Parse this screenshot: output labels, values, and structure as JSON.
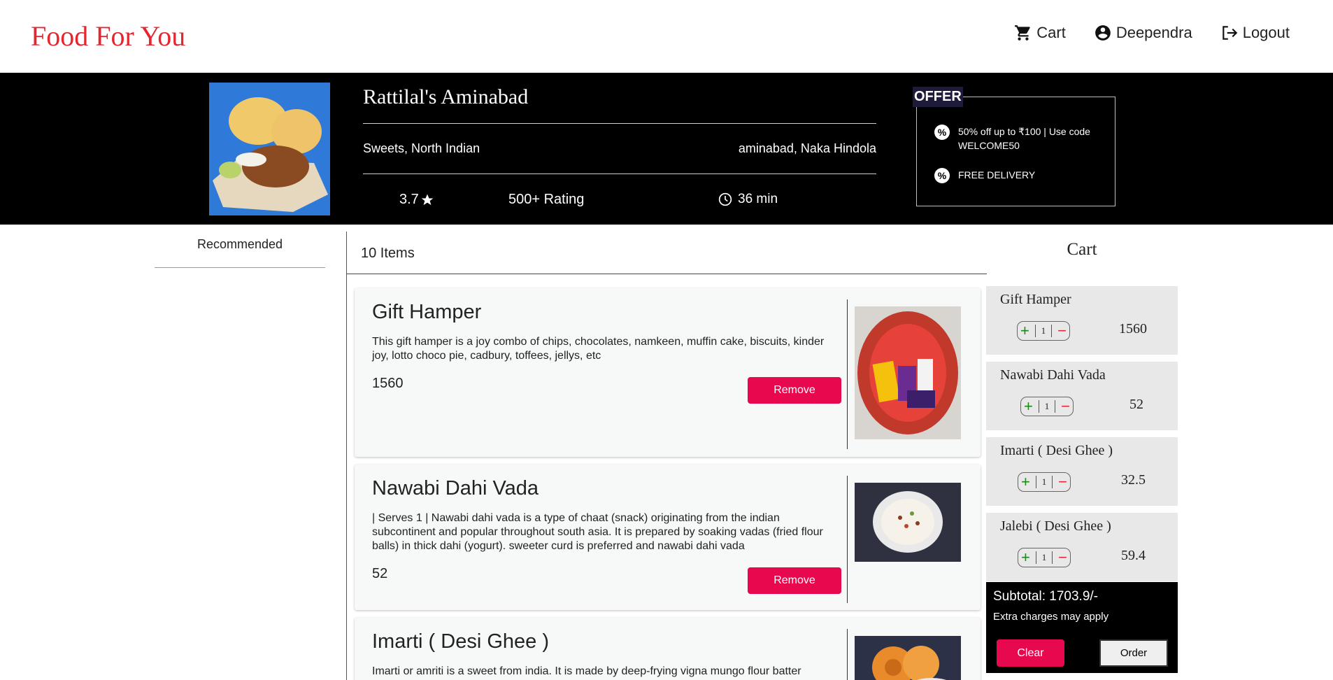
{
  "header": {
    "brand": "Food For You",
    "nav": {
      "cart_label": "Cart",
      "user_label": "Deependra",
      "logout_label": "Logout"
    }
  },
  "restaurant": {
    "name": "Rattilal's Aminabad",
    "cuisines": "Sweets, North Indian",
    "location": "aminabad, Naka Hindola",
    "rating": "3.7",
    "rating_count": "500+ Rating",
    "delivery_time": "36 min"
  },
  "offer": {
    "tag": "OFFER",
    "items": [
      "50% off up to ₹100 | Use code WELCOME50",
      "FREE DELIVERY"
    ]
  },
  "categories": [
    "Recommended"
  ],
  "menu": {
    "count_label": "10 Items",
    "remove_label": "Remove",
    "items": [
      {
        "title": "Gift Hamper",
        "description": "This gift hamper is a joy combo of chips, chocolates, namkeen, muffin cake, biscuits, kinder joy, lotto choco pie, cadbury, toffees, jellys, etc",
        "price": "1560",
        "image_icon": "gift-hamper-image"
      },
      {
        "title": "Nawabi Dahi Vada",
        "description": "| Serves 1 | Nawabi dahi vada is a type of chaat (snack) originating from the indian subcontinent and popular throughout south asia. It is prepared by soaking vadas (fried flour balls) in thick dahi (yogurt). sweeter curd is preferred and nawabi dahi vada",
        "price": "52",
        "image_icon": "dahi-vada-image"
      },
      {
        "title": "Imarti ( Desi Ghee )",
        "description": "Imarti or amriti is a sweet from india. It is made by deep-frying vigna mungo flour batter",
        "price": "",
        "image_icon": "imarti-image"
      }
    ]
  },
  "cart": {
    "title": "Cart",
    "items": [
      {
        "name": "Gift Hamper",
        "qty": "1",
        "price": "1560"
      },
      {
        "name": "Nawabi Dahi Vada",
        "qty": "1",
        "price": "52"
      },
      {
        "name": "Imarti ( Desi Ghee )",
        "qty": "1",
        "price": "32.5"
      },
      {
        "name": "Jalebi ( Desi Ghee )",
        "qty": "1",
        "price": "59.4"
      }
    ],
    "stepper_plus": "+",
    "stepper_minus": "−",
    "subtotal": "Subtotal: 1703.9/-",
    "extra_note": "Extra charges may apply",
    "clear_label": "Clear",
    "order_label": "Order"
  },
  "colors": {
    "brand": "#e3262f",
    "accent_button": "#e8084e",
    "banner_bg": "#000000",
    "cart_item_bg": "#e8e8e8"
  }
}
